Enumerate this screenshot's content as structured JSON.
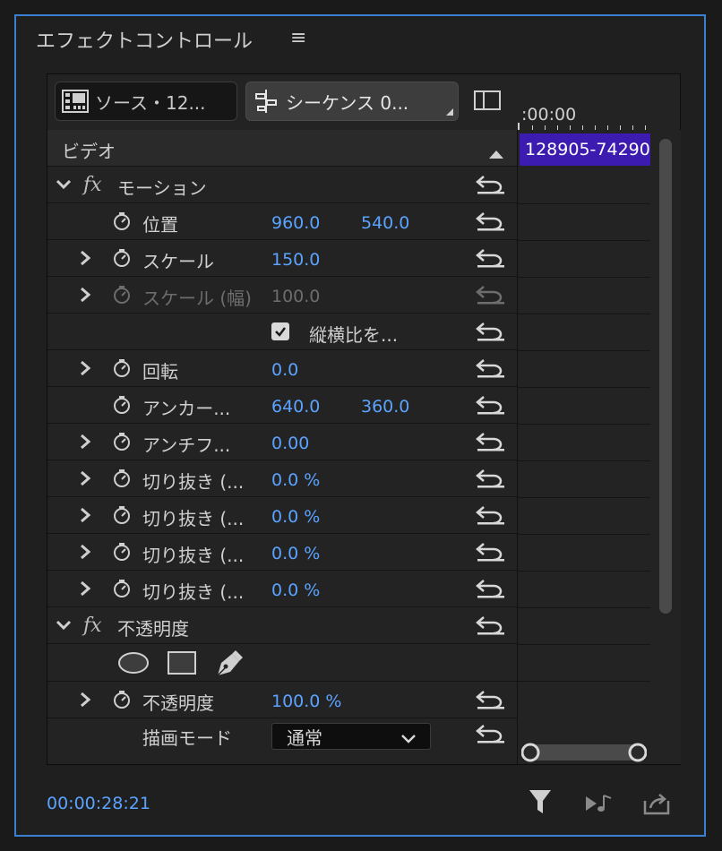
{
  "panel": {
    "title": "エフェクトコントロール",
    "menu_icon": "hamburger-icon"
  },
  "tabs": {
    "source_label": "ソース・12...",
    "sequence_label": "シーケンス 0..."
  },
  "timeline": {
    "timecode": ":00:00",
    "clip_label": "128905-74290"
  },
  "rows": {
    "video": "ビデオ",
    "motion": "モーション",
    "position": {
      "label": "位置",
      "x": "960.0",
      "y": "540.0"
    },
    "scale": {
      "label": "スケール",
      "value": "150.0"
    },
    "scale_width": {
      "label": "スケール (幅)",
      "value": "100.0"
    },
    "uniform": {
      "label": "縦横比を..."
    },
    "rotation": {
      "label": "回転",
      "value": "0.0"
    },
    "anchor": {
      "label": "アンカー...",
      "x": "640.0",
      "y": "360.0"
    },
    "anti_flicker": {
      "label": "アンチフ...",
      "value": "0.00"
    },
    "crop1": {
      "label": "切り抜き (...",
      "value": "0.0 %"
    },
    "crop2": {
      "label": "切り抜き (...",
      "value": "0.0 %"
    },
    "crop3": {
      "label": "切り抜き (...",
      "value": "0.0 %"
    },
    "crop4": {
      "label": "切り抜き (...",
      "value": "0.0 %"
    },
    "opacity_section": "不透明度",
    "opacity": {
      "label": "不透明度",
      "value": "100.0 %"
    },
    "blend": {
      "label": "描画モード",
      "value": "通常"
    }
  },
  "footer": {
    "timecode": "00:00:28:21"
  },
  "colors": {
    "accent": "#3a7fd0",
    "value_blue": "#5ba3ff",
    "clip": "#3b1bb0"
  }
}
